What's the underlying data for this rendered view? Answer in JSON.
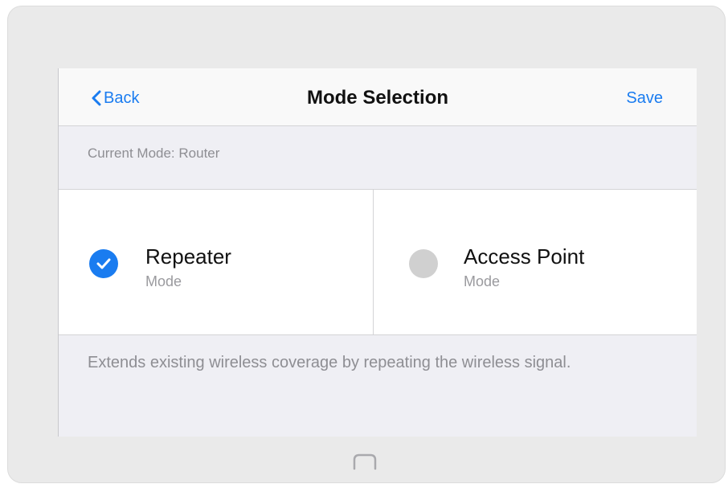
{
  "navbar": {
    "back_label": "Back",
    "title": "Mode Selection",
    "save_label": "Save"
  },
  "current_mode": "Current Mode: Router",
  "options": [
    {
      "title": "Repeater",
      "subtitle": "Mode",
      "selected": true
    },
    {
      "title": "Access Point",
      "subtitle": "Mode",
      "selected": false
    }
  ],
  "description": "Extends existing wireless coverage by repeating the wireless signal.",
  "icons": {
    "back": "chevron-left-icon",
    "selected": "checkmark-icon",
    "home": "home-button-icon"
  },
  "colors": {
    "accent": "#1a7cf0",
    "unselected_radio": "#d0d0d0",
    "background": "#efeff4"
  }
}
